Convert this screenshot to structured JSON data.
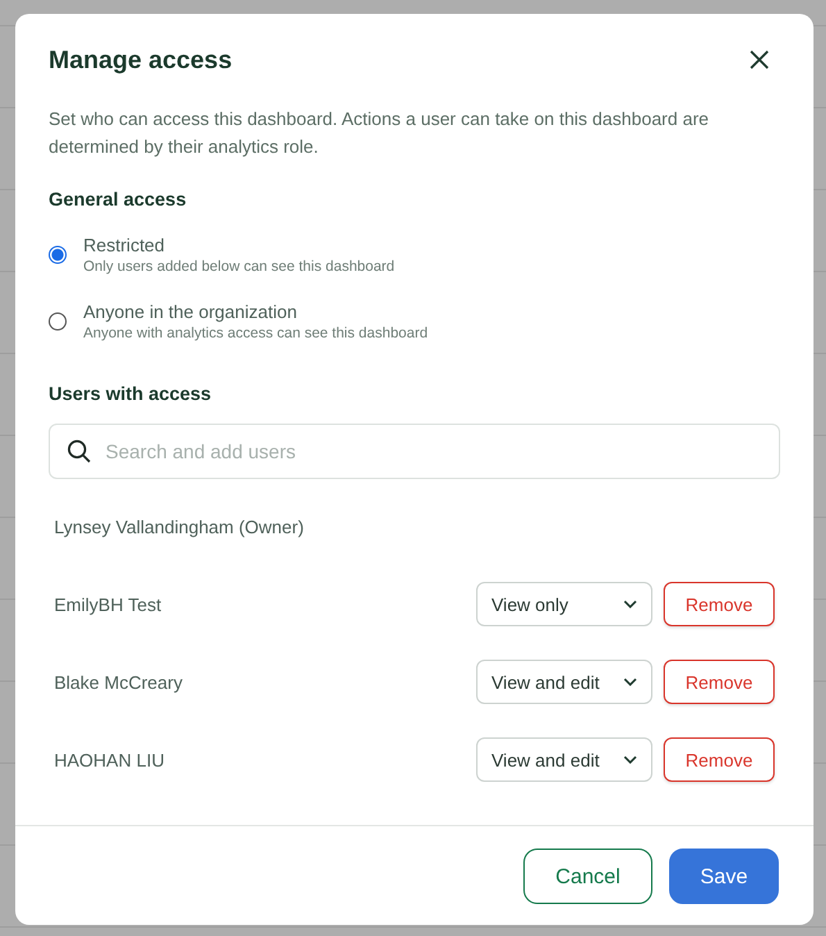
{
  "dialog": {
    "title": "Manage access",
    "description": "Set who can access this dashboard. Actions a user can take on this dashboard are determined by their analytics role."
  },
  "general_access": {
    "heading": "General access",
    "options": [
      {
        "label": "Restricted",
        "description": "Only users added below can see this dashboard",
        "selected": true
      },
      {
        "label": "Anyone in the organization",
        "description": "Anyone with analytics access can see this dashboard",
        "selected": false
      }
    ]
  },
  "users": {
    "heading": "Users with access",
    "search": {
      "placeholder": "Search and add users"
    },
    "owner": "Lynsey Vallandingham (Owner)",
    "members": [
      {
        "name": "EmilyBH Test",
        "role": "View only",
        "remove": "Remove"
      },
      {
        "name": "Blake McCreary",
        "role": "View and edit",
        "remove": "Remove"
      },
      {
        "name": "HAOHAN LIU",
        "role": "View and edit",
        "remove": "Remove"
      }
    ]
  },
  "footer": {
    "buttons": [
      {
        "label": "Cancel",
        "kind": "secondary"
      },
      {
        "label": "Save",
        "kind": "primary"
      }
    ]
  }
}
